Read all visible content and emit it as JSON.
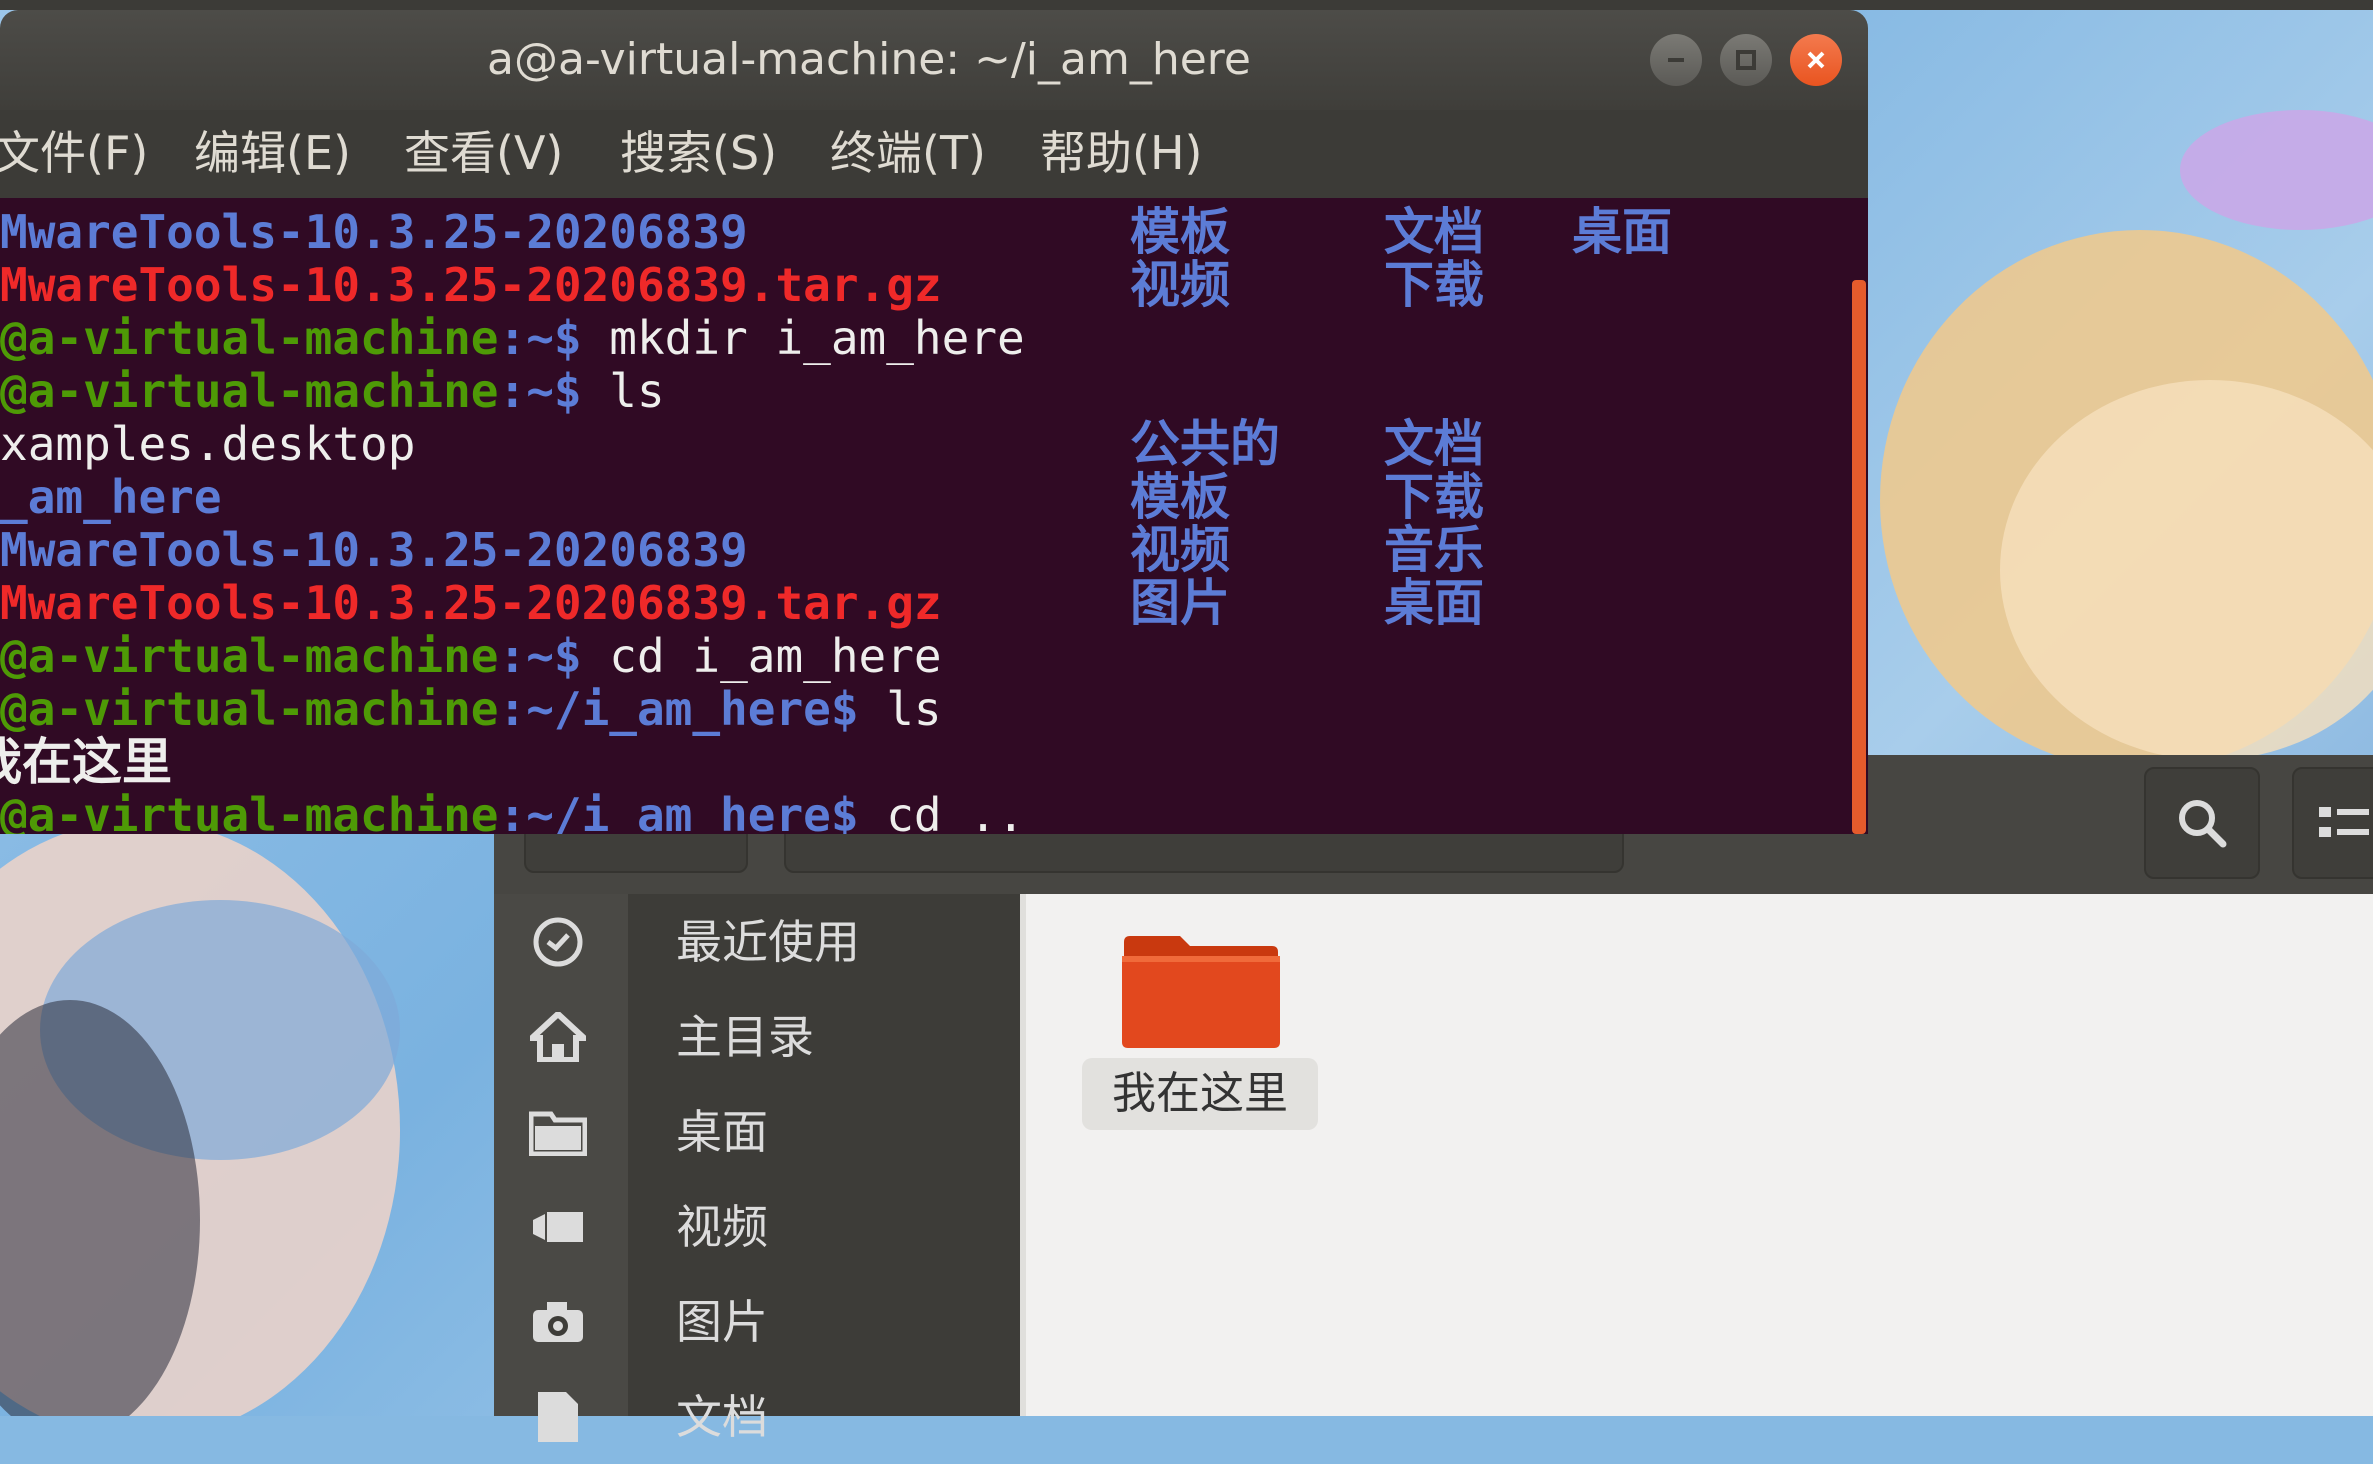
{
  "colors": {
    "terminal_bg": "#300a24",
    "prompt_green": "#4e9a06",
    "dir_blue": "#5c7cd6",
    "archive_red": "#ef2929",
    "close_button_orange": "#e95420",
    "folder_orange": "#e2481e"
  },
  "terminal": {
    "title": "a@a-virtual-machine: ~/i_am_here",
    "menu": [
      "文件(F)",
      "编辑(E)",
      "查看(V)",
      "搜索(S)",
      "终端(T)",
      "帮助(H)"
    ],
    "lines": {
      "l1": "MwareTools-10.3.25-20206839",
      "l2": "MwareTools-10.3.25-20206839.tar.gz",
      "l3_prompt": "@a-virtual-machine",
      "l3_path": ":~$",
      "l3_cmd": " mkdir i_am_here",
      "l4_prompt": "@a-virtual-machine",
      "l4_path": ":~$",
      "l4_cmd": " ls",
      "l5": "xamples.desktop",
      "l6": "_am_here",
      "l7": "MwareTools-10.3.25-20206839",
      "l8": "MwareTools-10.3.25-20206839.tar.gz",
      "l9_prompt": "@a-virtual-machine",
      "l9_path": ":~$",
      "l9_cmd": " cd i_am_here",
      "l10_prompt": "@a-virtual-machine",
      "l10_path": ":~/i_am_here$",
      "l10_cmd": " ls",
      "l11": "我在这里",
      "l12_prompt": "@a-virtual-machine",
      "l12_path": ":~/i_am_here$",
      "l12_cmd": " cd .."
    },
    "cells": {
      "r1a": "模板",
      "r1b": "文档",
      "r1c": "桌面",
      "r2a": "视频",
      "r2b": "下载",
      "r5a": "公共的",
      "r5b": "文档",
      "r6a": "模板",
      "r6b": "下载",
      "r7a": "视频",
      "r7b": "音乐",
      "r8a": "图片",
      "r8b": "桌面"
    }
  },
  "files": {
    "sidebar": [
      {
        "label": "最近使用",
        "icon": "clock-icon"
      },
      {
        "label": "主目录",
        "icon": "home-icon"
      },
      {
        "label": "桌面",
        "icon": "folder-icon"
      },
      {
        "label": "视频",
        "icon": "video-icon"
      },
      {
        "label": "图片",
        "icon": "camera-icon"
      },
      {
        "label": "文档",
        "icon": "document-icon"
      }
    ],
    "folder_label": "我在这里"
  }
}
